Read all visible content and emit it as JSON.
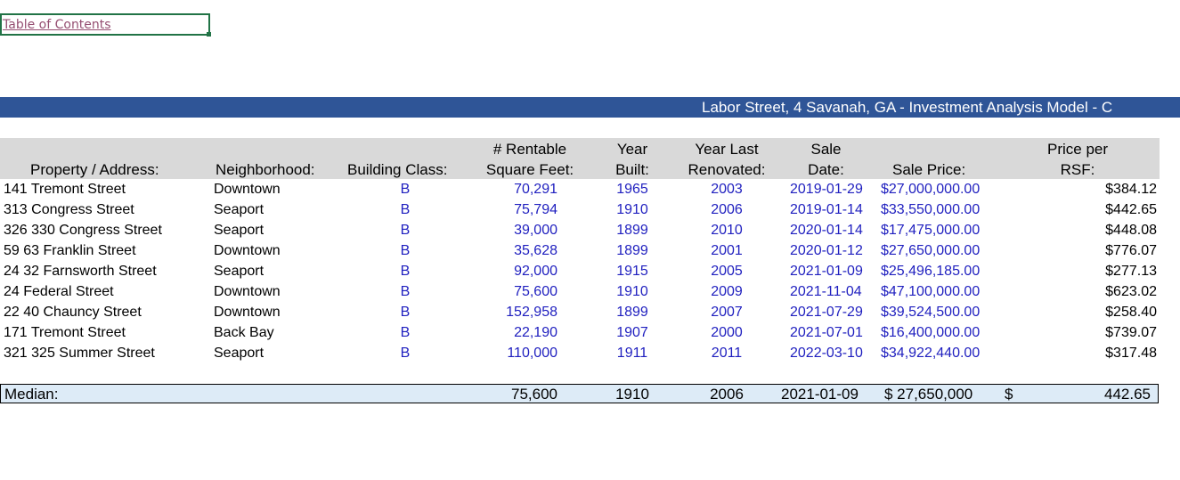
{
  "toc_link": "Table of Contents",
  "title": "Labor Street, 4 Savanah, GA - Investment Analysis Model - C",
  "headers": {
    "property_address": "Property / Address:",
    "neighborhood": "Neighborhood:",
    "building_class": "Building Class:",
    "rentable_line1": "# Rentable",
    "rentable_line2": "Square Feet:",
    "year_built_line1": "Year",
    "year_built_line2": "Built:",
    "year_last_line1": "Year Last",
    "year_last_line2": "Renovated:",
    "sale_date_line1": "Sale",
    "sale_date_line2": "Date:",
    "sale_price": "Sale Price:",
    "price_rsf_line1": "Price per",
    "price_rsf_line2": "RSF:"
  },
  "rows": [
    {
      "address": "141 Tremont Street",
      "neighborhood": "Downtown",
      "class": "B",
      "sqft": "70,291",
      "built": "1965",
      "renovated": "2003",
      "sale_date": "2019-01-29",
      "sale_price": "$27,000,000.00",
      "price_rsf": "$384.12"
    },
    {
      "address": "313 Congress Street",
      "neighborhood": "Seaport",
      "class": "B",
      "sqft": "75,794",
      "built": "1910",
      "renovated": "2006",
      "sale_date": "2019-01-14",
      "sale_price": "$33,550,000.00",
      "price_rsf": "$442.65"
    },
    {
      "address": "326 330 Congress Street",
      "neighborhood": "Seaport",
      "class": "B",
      "sqft": "39,000",
      "built": "1899",
      "renovated": "2010",
      "sale_date": "2020-01-14",
      "sale_price": "$17,475,000.00",
      "price_rsf": "$448.08"
    },
    {
      "address": "59 63 Franklin Street",
      "neighborhood": "Downtown",
      "class": "B",
      "sqft": "35,628",
      "built": "1899",
      "renovated": "2001",
      "sale_date": "2020-01-12",
      "sale_price": "$27,650,000.00",
      "price_rsf": "$776.07"
    },
    {
      "address": "24 32 Farnsworth Street",
      "neighborhood": "Seaport",
      "class": "B",
      "sqft": "92,000",
      "built": "1915",
      "renovated": "2005",
      "sale_date": "2021-01-09",
      "sale_price": "$25,496,185.00",
      "price_rsf": "$277.13"
    },
    {
      "address": "24 Federal Street",
      "neighborhood": "Downtown",
      "class": "B",
      "sqft": "75,600",
      "built": "1910",
      "renovated": "2009",
      "sale_date": "2021-11-04",
      "sale_price": "$47,100,000.00",
      "price_rsf": "$623.02"
    },
    {
      "address": "22 40 Chauncy Street",
      "neighborhood": "Downtown",
      "class": "B",
      "sqft": "152,958",
      "built": "1899",
      "renovated": "2007",
      "sale_date": "2021-07-29",
      "sale_price": "$39,524,500.00",
      "price_rsf": "$258.40"
    },
    {
      "address": "171 Tremont Street",
      "neighborhood": "Back Bay",
      "class": "B",
      "sqft": "22,190",
      "built": "1907",
      "renovated": "2000",
      "sale_date": "2021-07-01",
      "sale_price": "$16,400,000.00",
      "price_rsf": "$739.07"
    },
    {
      "address": "321 325 Summer Street",
      "neighborhood": "Seaport",
      "class": "B",
      "sqft": "110,000",
      "built": "1911",
      "renovated": "2011",
      "sale_date": "2022-03-10",
      "sale_price": "$34,922,440.00",
      "price_rsf": "$317.48"
    }
  ],
  "median": {
    "label": "Median:",
    "sqft": "75,600",
    "built": "1910",
    "renovated": "2006",
    "sale_date": "2021-01-09",
    "sale_price": "$ 27,650,000",
    "currency": "$",
    "price_rsf": "442.65"
  },
  "colors": {
    "title_band": "#2f5597",
    "header_band": "#d9d9d9",
    "median_band": "#ddebf7",
    "input_blue": "#1f1fbf",
    "link": "#954f72",
    "selection": "#217346"
  }
}
